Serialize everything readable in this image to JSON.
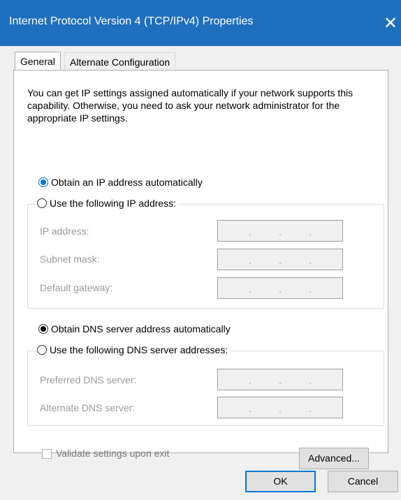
{
  "window": {
    "title": "Internet Protocol Version 4 (TCP/IPv4) Properties",
    "close_glyph": "✕"
  },
  "tabs": [
    {
      "label": "General",
      "active": true
    },
    {
      "label": "Alternate Configuration",
      "active": false
    }
  ],
  "description": "You can get IP settings assigned automatically if your network supports this capability. Otherwise, you need to ask your network administrator for the appropriate IP settings.",
  "ip_section": {
    "auto_label": "Obtain an IP address automatically",
    "manual_label": "Use the following IP address:",
    "auto_selected": true,
    "fields": [
      {
        "label": "IP address:"
      },
      {
        "label": "Subnet mask:"
      },
      {
        "label": "Default gateway:"
      }
    ]
  },
  "dns_section": {
    "auto_label": "Obtain DNS server address automatically",
    "manual_label": "Use the following DNS server addresses:",
    "auto_selected": true,
    "fields": [
      {
        "label": "Preferred DNS server:"
      },
      {
        "label": "Alternate DNS server:"
      }
    ]
  },
  "validate": {
    "label": "Validate settings upon exit",
    "checked": false
  },
  "buttons": {
    "advanced": "Advanced...",
    "ok": "OK",
    "cancel": "Cancel"
  },
  "ip_dot": ".",
  "colors": {
    "titlebar": "#1f6fbf",
    "accent": "#0078d7",
    "dialog_bg": "#f0f0f0"
  }
}
